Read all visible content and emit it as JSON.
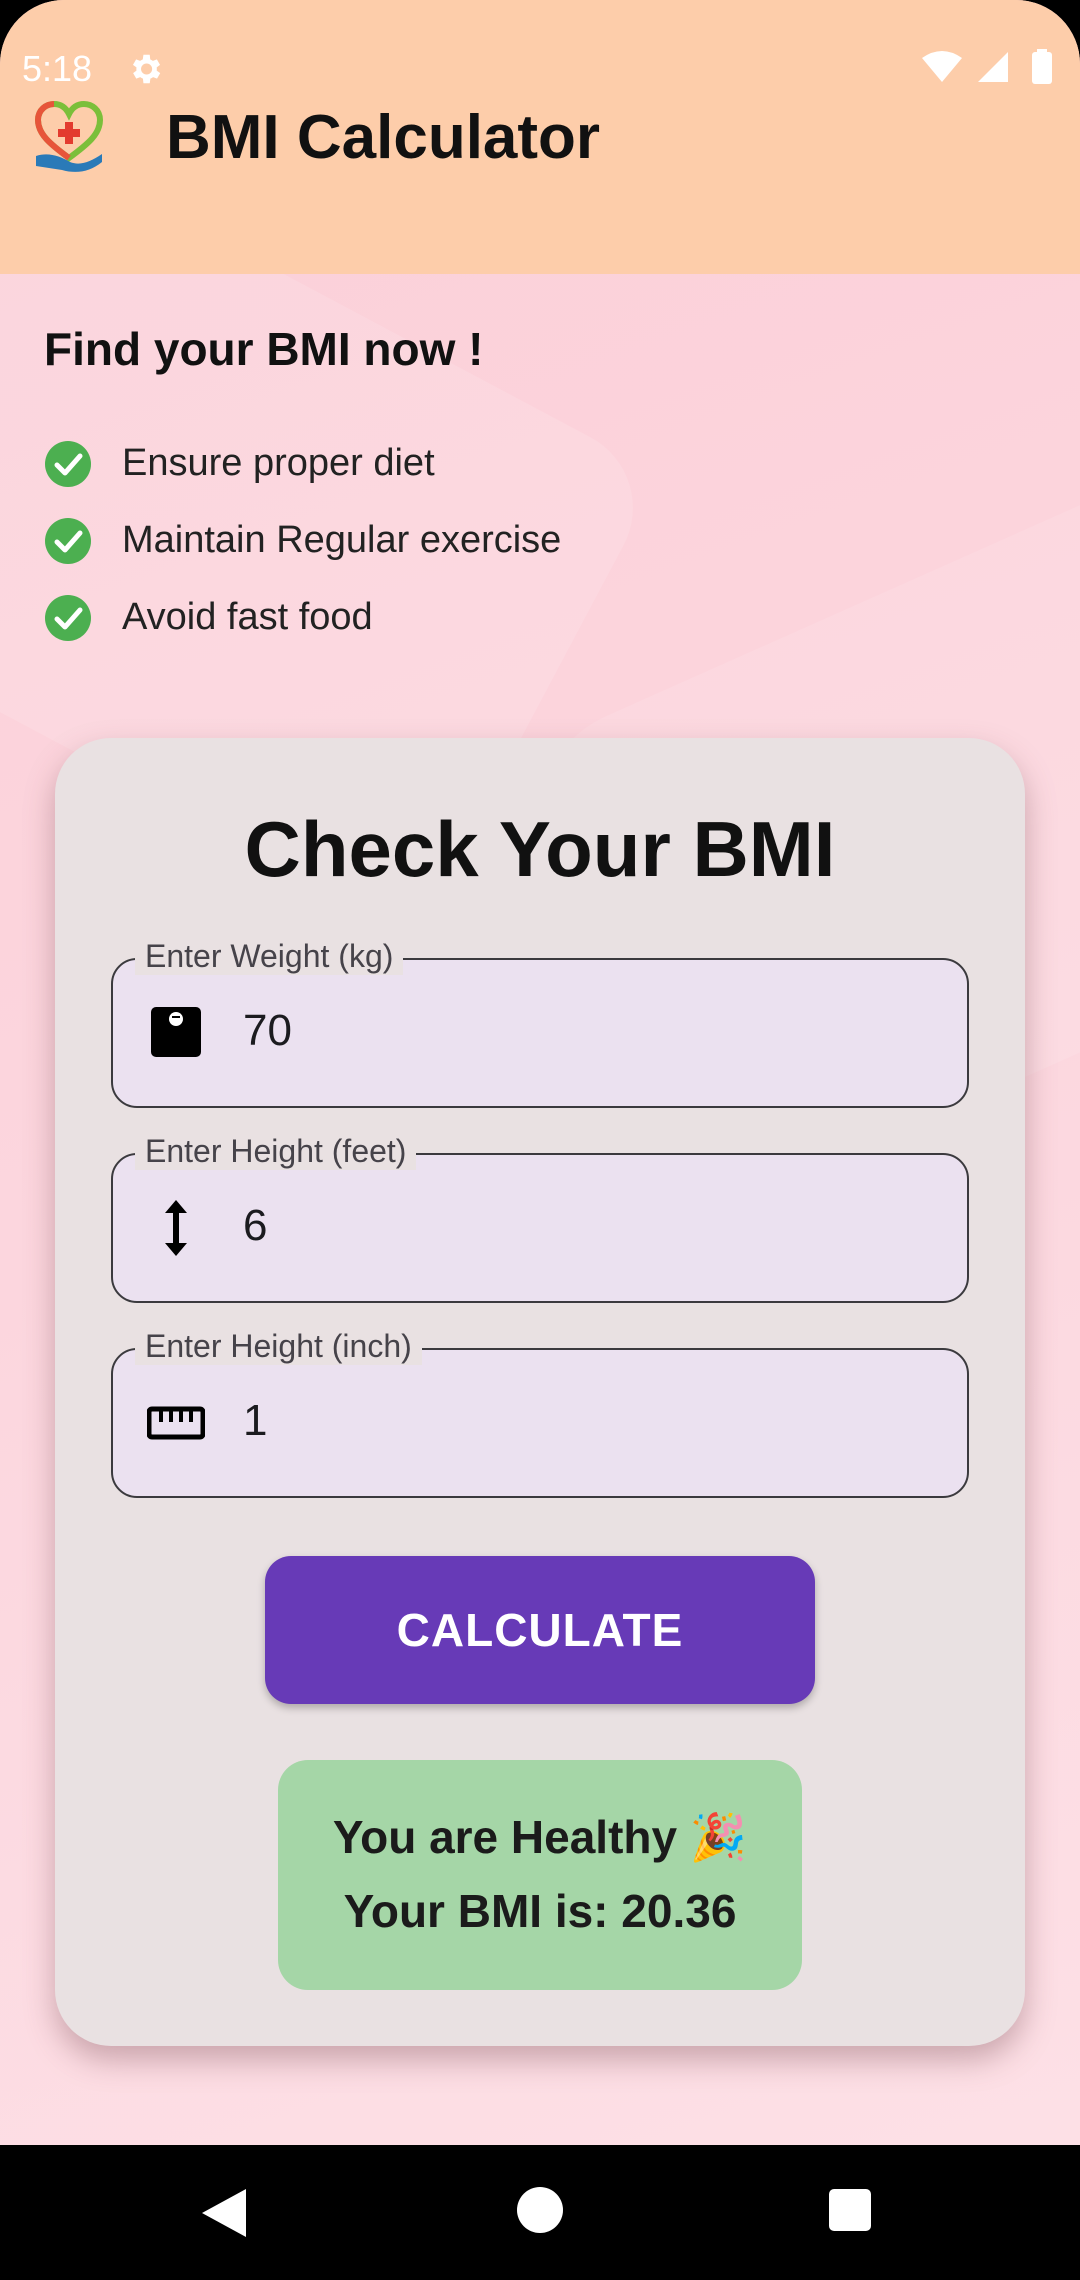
{
  "status_bar": {
    "time": "5:18",
    "icons": [
      "settings-icon",
      "wifi-icon",
      "signal-icon",
      "battery-icon"
    ]
  },
  "app_bar": {
    "title": "BMI Calculator",
    "logo_icon": "heart-hand-logo"
  },
  "intro": {
    "title": "Find your BMI now !",
    "tips": [
      {
        "label": "Ensure proper diet",
        "icon": "check-circle-icon"
      },
      {
        "label": "Maintain Regular exercise",
        "icon": "check-circle-icon"
      },
      {
        "label": "Avoid fast food",
        "icon": "check-circle-icon"
      }
    ]
  },
  "form": {
    "title": "Check Your BMI",
    "weight": {
      "label": "Enter Weight (kg)",
      "value": "70",
      "icon": "scale-icon"
    },
    "height_feet": {
      "label": "Enter Height (feet)",
      "value": "6",
      "icon": "height-arrows-icon"
    },
    "height_inch": {
      "label": "Enter Height (inch)",
      "value": "1",
      "icon": "ruler-icon"
    },
    "calculate_label": "CALCULATE"
  },
  "result": {
    "status": "You are Healthy 🎉",
    "bmi_text": "Your BMI is: 20.36"
  },
  "colors": {
    "app_bar": "#fdcdaa",
    "background": "#fcd6de",
    "card": "#e9e1e2",
    "primary": "#673ab7",
    "result_bg": "#a5d6a7",
    "check": "#4caf50"
  },
  "nav_bar": {
    "buttons": [
      "back-icon",
      "home-icon",
      "recents-icon"
    ]
  }
}
